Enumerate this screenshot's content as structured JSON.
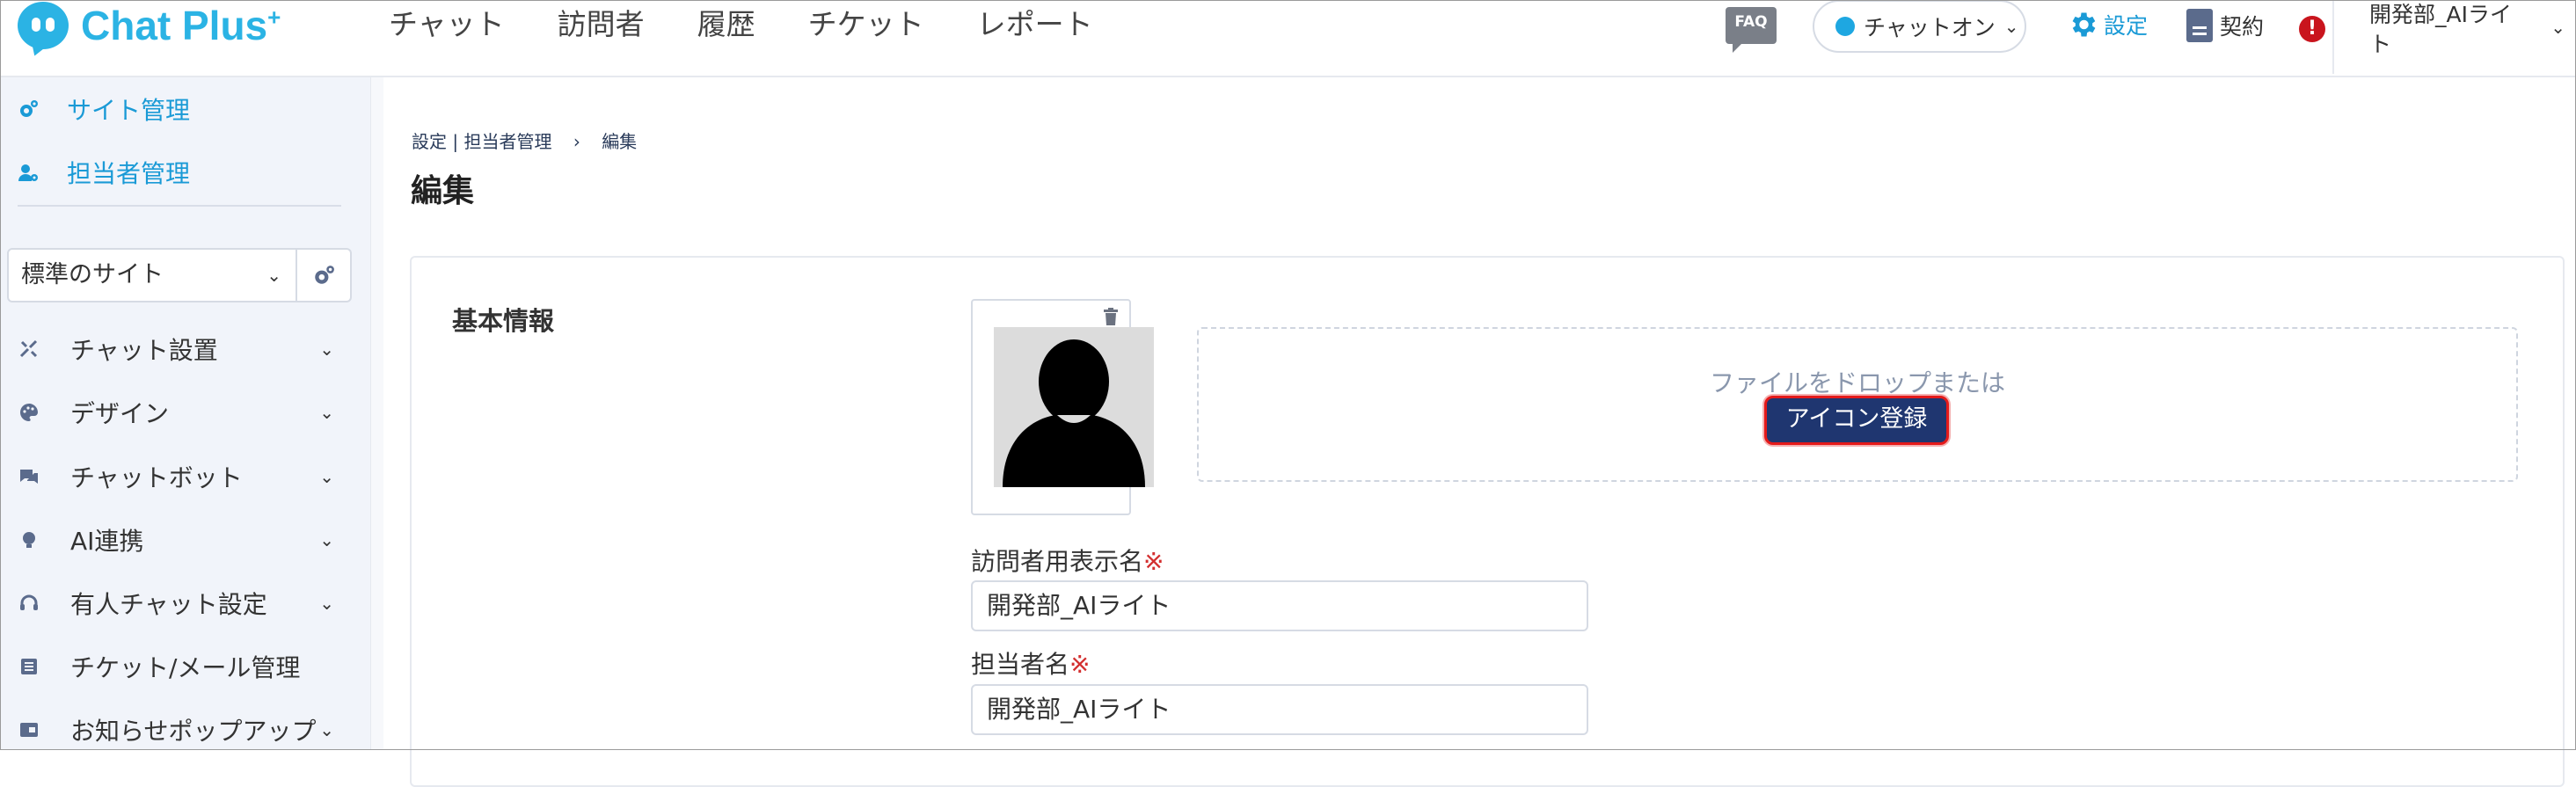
{
  "header": {
    "logo": "Chat Plus",
    "logo_sup": "+",
    "nav": [
      "チャット",
      "訪問者",
      "履歴",
      "チケット",
      "レポート"
    ],
    "faq": "FAQ",
    "chat_status": "チャットオン",
    "settings": "設定",
    "contract": "契約",
    "alert": "!",
    "user_line1": "開発部_AIライ",
    "user_line2": "ト"
  },
  "sidebar": {
    "site_mgmt": "サイト管理",
    "staff_mgmt": "担当者管理",
    "site_select": "標準のサイト",
    "menu": [
      {
        "label": "チャット設置",
        "icon": "tools-icon"
      },
      {
        "label": "デザイン",
        "icon": "palette-icon"
      },
      {
        "label": "チャットボット",
        "icon": "chat-bubble-icon"
      },
      {
        "label": "AI連携",
        "icon": "bulb-icon"
      },
      {
        "label": "有人チャット設定",
        "icon": "headset-icon"
      },
      {
        "label": "チケット/メール管理",
        "icon": "list-icon"
      },
      {
        "label": "お知らせポップアップ",
        "icon": "popup-icon"
      }
    ]
  },
  "content": {
    "breadcrumb": {
      "settings": "設定",
      "divider": "|",
      "staff": "担当者管理",
      "arrow": "›",
      "current": "編集"
    },
    "title": "編集",
    "section_title": "基本情報",
    "drop_text": "ファイルをドロップまたは",
    "icon_button": "アイコン登録",
    "visitor_name_label": "訪問者用表示名",
    "required_mark": "※",
    "visitor_name_value": "開発部_AIライト",
    "staff_name_label": "担当者名",
    "staff_name_value": "開発部_AIライト"
  },
  "colors": {
    "accent": "#2bb3e4",
    "link": "#1a9ad6",
    "button": "#1f3670",
    "highlight": "#e41a1a",
    "sidebar_bg": "#f1f4fa"
  }
}
